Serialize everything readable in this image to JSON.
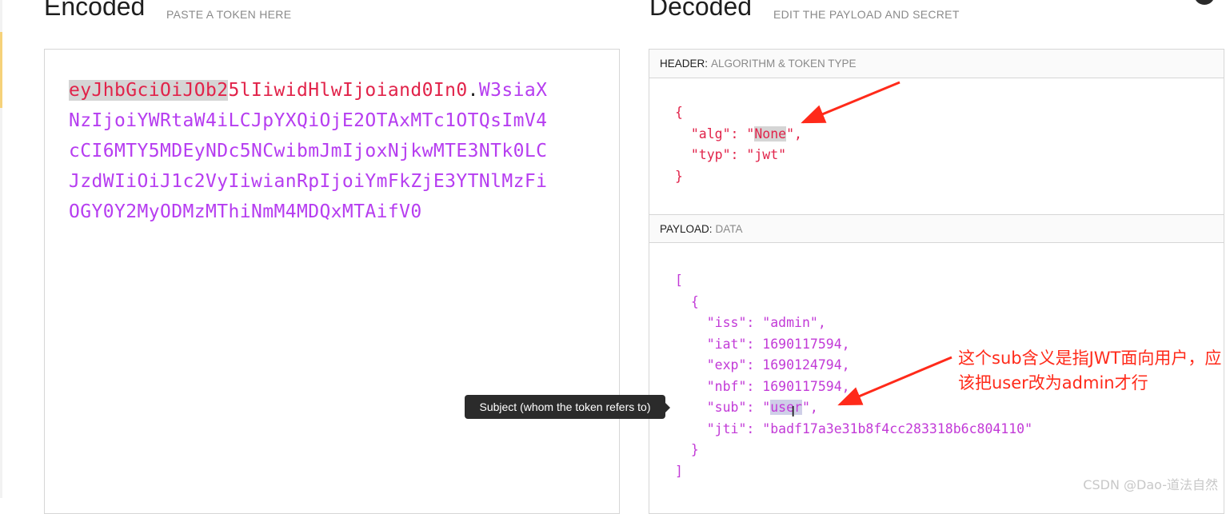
{
  "encoded": {
    "title": "Encoded",
    "subtitle": "PASTE A TOKEN HERE",
    "token_header_highlight": "eyJhbGciOiJOb2",
    "token_header_rest": "5lIiwidHlwIjoiand0In0",
    "token_dot": ".",
    "token_payload": "W3siaXNzIjoiYWRtaW4iLCJpYXQiOjE2OTAxMTc1OTQsImV4cCI6MTY5MDEyNDc5NCwibmJmIjoxNjkwMTE3NTk0LCJzdWIiOiJ1c2VyIiwianRpIjoiYmFkZjE3YTNlMzFiOGY0Y2MyODMzMThiNmM4MDQxMTAifV0"
  },
  "decoded": {
    "title": "Decoded",
    "subtitle": "EDIT THE PAYLOAD AND SECRET",
    "header_label": "HEADER:",
    "header_desc": "ALGORITHM & TOKEN TYPE",
    "payload_label": "PAYLOAD:",
    "payload_desc": "DATA",
    "header_json": {
      "open": "{",
      "alg_key": "\"alg\"",
      "alg_q1": "\"",
      "alg_val": "None",
      "alg_q2": "\",",
      "typ_key": "\"typ\"",
      "typ_val": "\"jwt\"",
      "close": "}"
    },
    "payload_json": {
      "arr_open": "[",
      "obj_open": "{",
      "iss_key": "\"iss\"",
      "iss_val": "\"admin\",",
      "iat_key": "\"iat\"",
      "iat_val": "1690117594,",
      "exp_key": "\"exp\"",
      "exp_val": "1690124794,",
      "nbf_key": "\"nbf\"",
      "nbf_val": "1690117594,",
      "sub_key": "\"sub\"",
      "sub_q1": "\"",
      "sub_val": "user",
      "sub_q2": "\",",
      "jti_key": "\"jti\"",
      "jti_val": "\"badf17a3e31b8f4cc283318b6c804110\"",
      "obj_close": "}",
      "arr_close": "]"
    }
  },
  "tooltip": "Subject (whom the token refers to)",
  "annotation": "这个sub含义是指JWT面向用户，应该把user改为admin才行",
  "watermark": "CSDN @Dao-道法自然",
  "colors": {
    "header_red": "#e1234a",
    "payload_purple": "#b63df0",
    "annotation_red": "#ff2a1a"
  }
}
